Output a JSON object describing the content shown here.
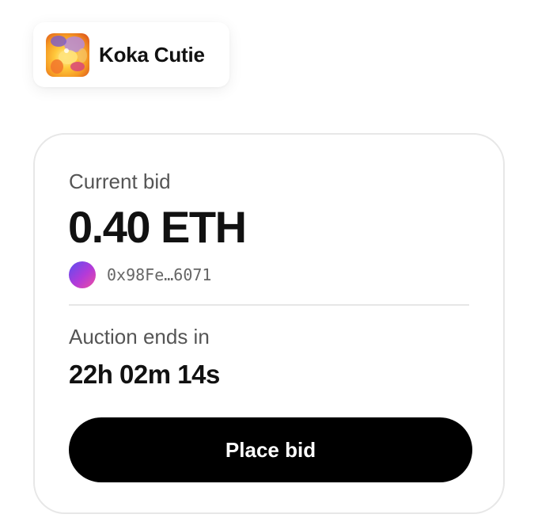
{
  "collection": {
    "name": "Koka Cutie",
    "thumbnail_icon": "nft-artwork-thumbnail"
  },
  "bid_card": {
    "current_bid_label": "Current bid",
    "current_bid_amount": "0.40 ETH",
    "bidder_address": "0x98Fe…6071",
    "auction_label": "Auction ends in",
    "countdown": "22h 02m 14s",
    "place_bid_label": "Place bid"
  },
  "colors": {
    "button_background": "#000000",
    "button_text": "#ffffff",
    "card_border": "#e7e7e7",
    "avatar_gradient": [
      "#5b4df0",
      "#b43ad8",
      "#ee4fa0"
    ]
  }
}
